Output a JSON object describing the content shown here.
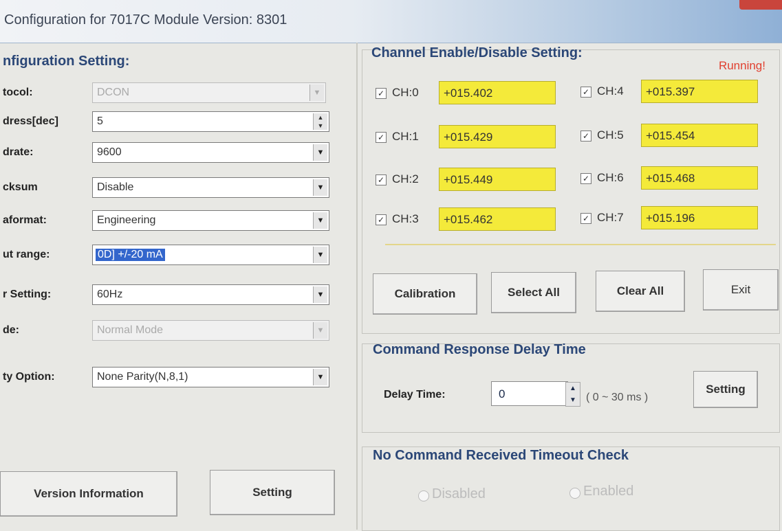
{
  "window": {
    "title": "Configuration for 7017C Module Version: 8301"
  },
  "config": {
    "heading": "nfiguration Setting:",
    "rows": [
      {
        "label": "tocol:",
        "value": "DCON",
        "control": "combo",
        "disabled": true
      },
      {
        "label": "dress[dec]",
        "value": "5",
        "control": "spin",
        "disabled": false
      },
      {
        "label": "drate:",
        "value": "9600",
        "control": "combo",
        "disabled": false
      },
      {
        "label": "cksum",
        "value": "Disable",
        "control": "combo",
        "disabled": false
      },
      {
        "label": "aformat:",
        "value": "Engineering",
        "control": "combo",
        "disabled": false
      },
      {
        "label": "ut range:",
        "value": "0D] +/-20 mA",
        "control": "combo",
        "disabled": false,
        "selected": true
      },
      {
        "label": "r Setting:",
        "value": "60Hz",
        "control": "combo",
        "disabled": false
      },
      {
        "label": "de:",
        "value": "Normal Mode",
        "control": "combo",
        "disabled": true
      },
      {
        "label": "ty Option:",
        "value": "None Parity(N,8,1)",
        "control": "combo",
        "disabled": false
      }
    ],
    "version_button": "Version Information",
    "setting_button": "Setting"
  },
  "channels": {
    "heading": "Channel Enable/Disable Setting:",
    "status": "Running!",
    "checked_mark": "✓",
    "items": [
      {
        "label": "CH:0",
        "value": "+015.402",
        "checked": true
      },
      {
        "label": "CH:1",
        "value": "+015.429",
        "checked": true
      },
      {
        "label": "CH:2",
        "value": "+015.449",
        "checked": true
      },
      {
        "label": "CH:3",
        "value": "+015.462",
        "checked": true
      },
      {
        "label": "CH:4",
        "value": "+015.397",
        "checked": true
      },
      {
        "label": "CH:5",
        "value": "+015.454",
        "checked": true
      },
      {
        "label": "CH:6",
        "value": "+015.468",
        "checked": true
      },
      {
        "label": "CH:7",
        "value": "+015.196",
        "checked": true
      }
    ],
    "buttons": {
      "calibration": "Calibration",
      "select_all": "Select All",
      "clear_all": "Clear All",
      "exit": "Exit"
    }
  },
  "delay": {
    "heading": "Command Response Delay Time",
    "label": "Delay Time:",
    "value": "0",
    "range": "( 0 ~ 30 ms )",
    "setting_button": "Setting"
  },
  "timeout": {
    "heading": "No Command Received Timeout Check",
    "options": [
      "Disabled",
      "Enabled"
    ]
  },
  "colors": {
    "value_bg": "#f4ea3a",
    "status": "#e04030",
    "heading": "#2b4777"
  },
  "icons": {
    "dropdown": "chevron-down-icon",
    "spin": "spin-arrows-icon",
    "checkbox": "checkbox-icon"
  }
}
